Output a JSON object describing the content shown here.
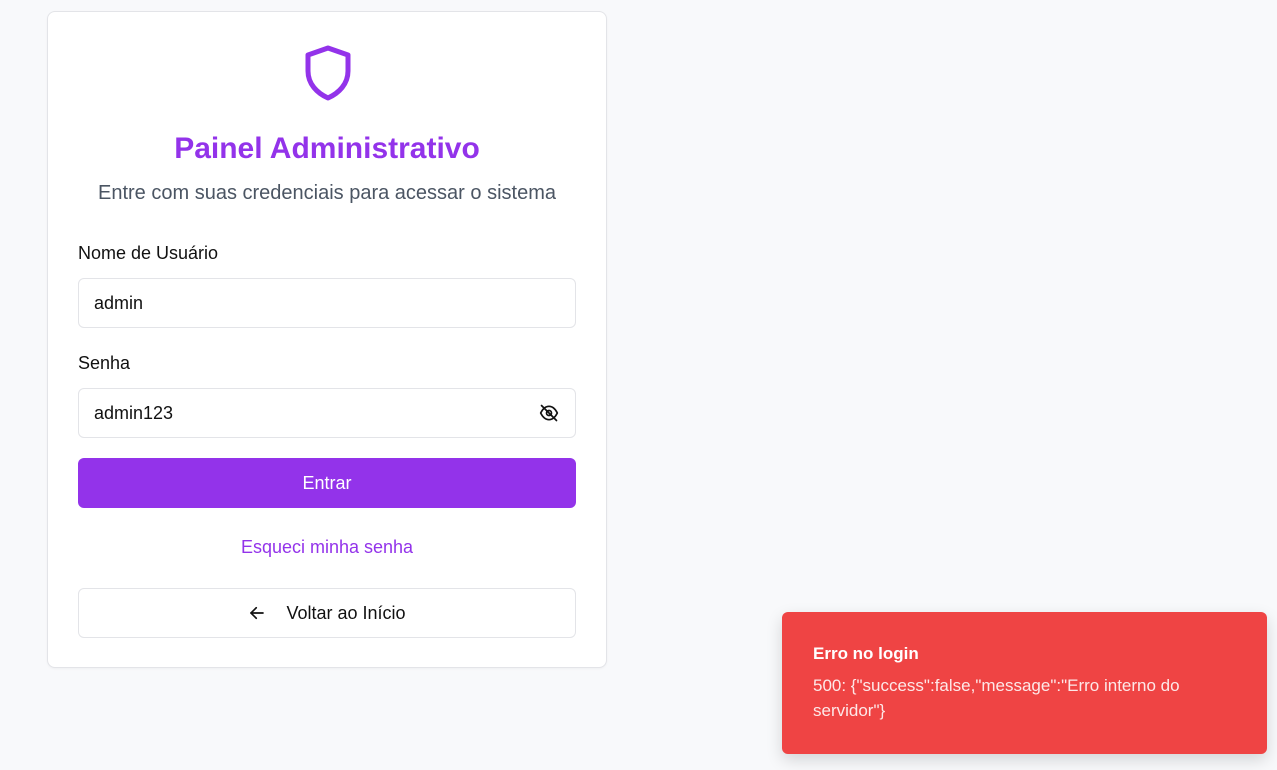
{
  "login": {
    "title": "Painel Administrativo",
    "subtitle": "Entre com suas credenciais para acessar o sistema",
    "username_label": "Nome de Usuário",
    "username_value": "admin",
    "password_label": "Senha",
    "password_value": "admin123",
    "submit_label": "Entrar",
    "forgot_label": "Esqueci minha senha",
    "back_label": "Voltar ao Início"
  },
  "toast": {
    "title": "Erro no login",
    "message": "500: {\"success\":false,\"message\":\"Erro interno do servidor\"}"
  },
  "icons": {
    "logo": "shield-icon",
    "password_toggle": "eye-off-icon",
    "back": "arrow-left-icon"
  },
  "colors": {
    "accent": "#9333ea",
    "error": "#ef4444",
    "background": "#f8f9fb"
  }
}
